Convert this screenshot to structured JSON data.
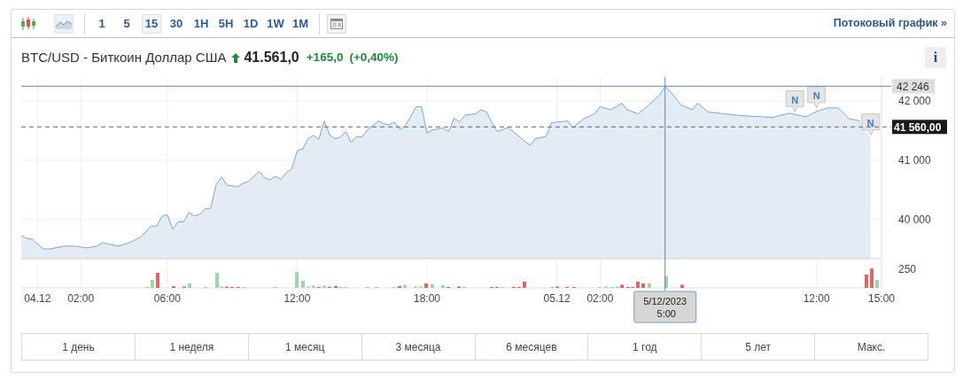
{
  "toolbar": {
    "chart_types": [
      {
        "kind": "candles",
        "selected": false
      },
      {
        "kind": "area",
        "selected": true
      }
    ],
    "intervals": [
      {
        "label": "1",
        "selected": false
      },
      {
        "label": "5",
        "selected": false
      },
      {
        "label": "15",
        "selected": true
      },
      {
        "label": "30",
        "selected": false
      },
      {
        "label": "1H",
        "selected": false
      },
      {
        "label": "5H",
        "selected": false
      },
      {
        "label": "1D",
        "selected": false
      },
      {
        "label": "1W",
        "selected": false
      },
      {
        "label": "1M",
        "selected": false
      }
    ],
    "streaming_link": "Потоковый график »"
  },
  "quote": {
    "name": "BTC/USD - Биткоин Доллар США",
    "rising": true,
    "price": "41.561,0",
    "change": "+165,0",
    "change_percent": "(+0,40%)",
    "info_button": "i"
  },
  "chart": {
    "chart_data": {
      "type": "area",
      "grid": true,
      "x": [
        "2023-12-03T23:15",
        "2023-12-03T23:30",
        "2023-12-03T23:45",
        "2023-12-04T00:15",
        "2023-12-04T00:30",
        "2023-12-04T01:15",
        "2023-12-04T01:45",
        "2023-12-04T02:15",
        "2023-12-04T02:45",
        "2023-12-04T03:00",
        "2023-12-04T03:45",
        "2023-12-04T04:15",
        "2023-12-04T04:45",
        "2023-12-04T05:15",
        "2023-12-04T05:30",
        "2023-12-04T05:45",
        "2023-12-04T06:00",
        "2023-12-04T06:15",
        "2023-12-04T06:30",
        "2023-12-04T06:45",
        "2023-12-04T07:00",
        "2023-12-04T07:15",
        "2023-12-04T07:30",
        "2023-12-04T07:45",
        "2023-12-04T08:00",
        "2023-12-04T08:15",
        "2023-12-04T08:30",
        "2023-12-04T08:45",
        "2023-12-04T09:15",
        "2023-12-04T09:30",
        "2023-12-04T09:45",
        "2023-12-04T10:15",
        "2023-12-04T10:30",
        "2023-12-04T10:45",
        "2023-12-04T11:00",
        "2023-12-04T11:15",
        "2023-12-04T11:30",
        "2023-12-04T11:45",
        "2023-12-04T12:00",
        "2023-12-04T12:15",
        "2023-12-04T12:30",
        "2023-12-04T12:45",
        "2023-12-04T13:00",
        "2023-12-04T13:15",
        "2023-12-04T13:30",
        "2023-12-04T13:45",
        "2023-12-04T14:00",
        "2023-12-04T14:15",
        "2023-12-04T14:30",
        "2023-12-04T14:45",
        "2023-12-04T15:00",
        "2023-12-04T15:15",
        "2023-12-04T15:45",
        "2023-12-04T16:00",
        "2023-12-04T16:15",
        "2023-12-04T16:30",
        "2023-12-04T16:45",
        "2023-12-04T17:00",
        "2023-12-04T17:30",
        "2023-12-04T17:45",
        "2023-12-04T18:00",
        "2023-12-04T18:15",
        "2023-12-04T18:45",
        "2023-12-04T19:00",
        "2023-12-04T19:15",
        "2023-12-04T19:30",
        "2023-12-04T19:45",
        "2023-12-04T20:15",
        "2023-12-04T20:30",
        "2023-12-04T20:45",
        "2023-12-04T21:00",
        "2023-12-04T21:15",
        "2023-12-04T21:45",
        "2023-12-04T22:15",
        "2023-12-04T22:45",
        "2023-12-04T23:00",
        "2023-12-04T23:30",
        "2023-12-04T23:45",
        "2023-12-05T00:30",
        "2023-12-05T00:45",
        "2023-12-05T01:15",
        "2023-12-05T01:45",
        "2023-12-05T02:00",
        "2023-12-05T02:30",
        "2023-12-05T03:00",
        "2023-12-05T03:15",
        "2023-12-05T03:45",
        "2023-12-05T04:15",
        "2023-12-05T04:45",
        "2023-12-05T05:00",
        "2023-12-05T05:15",
        "2023-12-05T05:45",
        "2023-12-05T06:15",
        "2023-12-05T06:30",
        "2023-12-05T07:00",
        "2023-12-05T07:45",
        "2023-12-05T08:30",
        "2023-12-05T09:30",
        "2023-12-05T10:00",
        "2023-12-05T10:15",
        "2023-12-05T10:45",
        "2023-12-05T11:15",
        "2023-12-05T11:30",
        "2023-12-05T12:00",
        "2023-12-05T12:15",
        "2023-12-05T12:30",
        "2023-12-05T13:00",
        "2023-12-05T13:30",
        "2023-12-05T14:00",
        "2023-12-05T14:15",
        "2023-12-05T14:30"
      ],
      "series": [
        {
          "color": "#7ea6cc",
          "values": [
            39730,
            39680,
            39670,
            39510,
            39500,
            39550,
            39550,
            39520,
            39550,
            39610,
            39550,
            39610,
            39700,
            39890,
            39890,
            40050,
            40080,
            39840,
            39960,
            39960,
            40120,
            40060,
            40090,
            40180,
            40190,
            40580,
            40720,
            40580,
            40550,
            40610,
            40640,
            40810,
            40700,
            40670,
            40730,
            40670,
            40790,
            40850,
            41160,
            41190,
            41360,
            41420,
            41350,
            41660,
            41430,
            41360,
            41390,
            41480,
            41300,
            41400,
            41390,
            41510,
            41660,
            41610,
            41600,
            41640,
            41510,
            41580,
            41900,
            41900,
            41450,
            41510,
            41540,
            41480,
            41710,
            41640,
            41760,
            41780,
            41850,
            41810,
            41630,
            41480,
            41550,
            41400,
            41250,
            41360,
            41400,
            41630,
            41660,
            41550,
            41700,
            41780,
            41900,
            41850,
            41960,
            41850,
            41780,
            41930,
            42100,
            42246,
            42150,
            41930,
            41850,
            41960,
            41810,
            41780,
            41750,
            41730,
            41720,
            41750,
            41790,
            41750,
            41730,
            41820,
            41850,
            41880,
            41880,
            41700,
            41660,
            null,
            41360
          ]
        }
      ],
      "xlim": [
        "2023-12-03T23:15",
        "2023-12-05T15:00"
      ],
      "ylim": [
        39340,
        42400
      ],
      "xticks": [
        {
          "value": "2023-12-04T00:00",
          "label": "04.12"
        },
        {
          "value": "2023-12-04T02:00",
          "label": "02:00"
        },
        {
          "value": "2023-12-04T06:00",
          "label": "06:00"
        },
        {
          "value": "2023-12-04T12:00",
          "label": "12:00"
        },
        {
          "value": "2023-12-04T18:00",
          "label": "18:00"
        },
        {
          "value": "2023-12-05T00:00",
          "label": "05.12"
        },
        {
          "value": "2023-12-05T02:00",
          "label": "02:00"
        },
        {
          "value": "2023-12-05T12:00",
          "label": "12:00"
        },
        {
          "value": "2023-12-05T15:00",
          "label": "15:00"
        }
      ],
      "yticks": [
        {
          "value": 40000,
          "label": "40 000"
        },
        {
          "value": 41000,
          "label": "41 000"
        },
        {
          "value": 42000,
          "label": "42 000"
        }
      ],
      "ref_lines": [
        {
          "axis": "y",
          "value": 42246,
          "label": "42 246"
        },
        {
          "axis": "y",
          "value": 41560,
          "label": "41 560,00"
        },
        {
          "axis": "x",
          "value": "2023-12-05T05:00",
          "label": "5/12/2023 5:00"
        }
      ],
      "annotations": [
        {
          "text": "N",
          "x": "2023-12-05T11:00",
          "y": 41750
        },
        {
          "text": "N",
          "x": "2023-12-05T12:00",
          "y": 41820
        },
        {
          "text": "N",
          "x": "2023-12-05T14:30",
          "y": 41360
        }
      ]
    },
    "volume_tick": "250"
  },
  "ranges": [
    {
      "label": "1 день"
    },
    {
      "label": "1 неделя"
    },
    {
      "label": "1 месяц"
    },
    {
      "label": "3 месяца"
    },
    {
      "label": "6 месяцев"
    },
    {
      "label": "1 год"
    },
    {
      "label": "5 лет"
    },
    {
      "label": "Макс."
    }
  ]
}
